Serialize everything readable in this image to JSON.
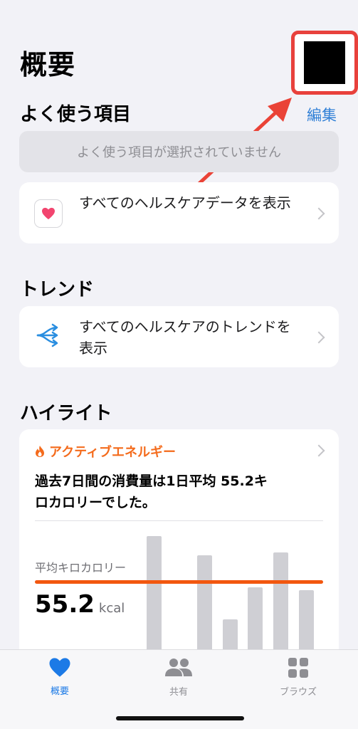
{
  "header": {
    "title": "概要"
  },
  "favorites": {
    "title": "よく使う項目",
    "edit_label": "編集",
    "empty_text": "よく使う項目が選択されていません",
    "show_all_label": "すべてのヘルスケアデータを表示"
  },
  "trends": {
    "title": "トレンド",
    "show_all_label": "すべてのヘルスケアのトレンドを表示"
  },
  "highlights": {
    "title": "ハイライト",
    "card": {
      "category": "アクティブエネルギー",
      "summary": "過去7日間の消費量は1日平均 55.2キロカロリーでした。",
      "avg_label": "平均キロカロリー",
      "avg_value": "55.2",
      "avg_unit": "kcal"
    }
  },
  "chart_data": {
    "type": "bar",
    "values": [
      100,
      85,
      35,
      60,
      87,
      58
    ],
    "average": 55.2
  },
  "tabbar": {
    "tabs": [
      {
        "label": "概要",
        "icon": "heart-icon",
        "active": true
      },
      {
        "label": "共有",
        "icon": "people-icon",
        "active": false
      },
      {
        "label": "ブラウズ",
        "icon": "grid-icon",
        "active": false
      }
    ]
  },
  "colors": {
    "accent_blue": "#2f7fd6",
    "highlight_red": "#e8413c",
    "energy_orange": "#f46b1c",
    "avg_line": "#f2570f"
  }
}
